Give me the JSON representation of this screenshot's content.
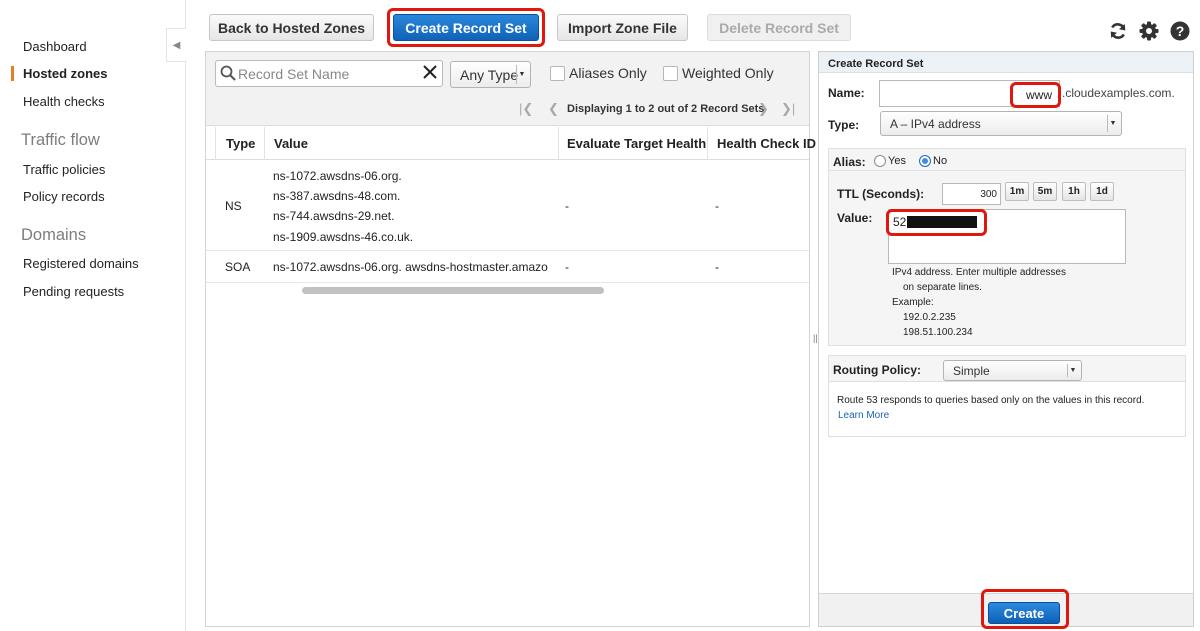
{
  "sidebar": {
    "items": [
      {
        "label": "Dashboard"
      },
      {
        "label": "Hosted zones"
      },
      {
        "label": "Health checks"
      }
    ],
    "sections": [
      {
        "title": "Traffic flow",
        "items": [
          {
            "label": "Traffic policies"
          },
          {
            "label": "Policy records"
          }
        ]
      },
      {
        "title": "Domains",
        "items": [
          {
            "label": "Registered domains"
          },
          {
            "label": "Pending requests"
          }
        ]
      }
    ]
  },
  "toolbar": {
    "back_label": "Back to Hosted Zones",
    "create_label": "Create Record Set",
    "import_label": "Import Zone File",
    "delete_label": "Delete Record Set"
  },
  "filters": {
    "search_placeholder": "Record Set Name",
    "type_value": "Any Type",
    "aliases_label": "Aliases Only",
    "weighted_label": "Weighted Only"
  },
  "pager": {
    "text": "Displaying 1 to 2 out of 2 Record Sets"
  },
  "table": {
    "headers": [
      "Type",
      "Value",
      "Evaluate Target Health",
      "Health Check ID"
    ],
    "rows": [
      {
        "type": "NS",
        "values": [
          "ns-1072.awsdns-06.org.",
          "ns-387.awsdns-48.com.",
          "ns-744.awsdns-29.net.",
          "ns-1909.awsdns-46.co.uk."
        ],
        "eval": "-",
        "health": "-"
      },
      {
        "type": "SOA",
        "values": [
          "ns-1072.awsdns-06.org. awsdns-hostmaster.amazo"
        ],
        "eval": "-",
        "health": "-"
      }
    ]
  },
  "form": {
    "title": "Create Record Set",
    "name_label": "Name:",
    "name_value": "www",
    "name_suffix": ".cloudexamples.com.",
    "type_label": "Type:",
    "type_value": "A – IPv4 address",
    "alias_label": "Alias:",
    "alias_yes": "Yes",
    "alias_no": "No",
    "ttl_label": "TTL (Seconds):",
    "ttl_value": "300",
    "ttl_presets": [
      "1m",
      "5m",
      "1h",
      "1d"
    ],
    "value_label": "Value:",
    "value_text": "52",
    "hint_lines": [
      "IPv4 address. Enter multiple addresses",
      "on separate lines.",
      "Example:",
      "192.0.2.235",
      "198.51.100.234"
    ],
    "routing_label": "Routing Policy:",
    "routing_value": "Simple",
    "routing_help": "Route 53 responds to queries based only on the values in this record.",
    "learn_more": "Learn More",
    "create_label": "Create"
  },
  "colors": {
    "accent": "#e87e1f",
    "primary": "#1570c9",
    "highlight": "#e0170d",
    "link": "#1a63b5"
  }
}
